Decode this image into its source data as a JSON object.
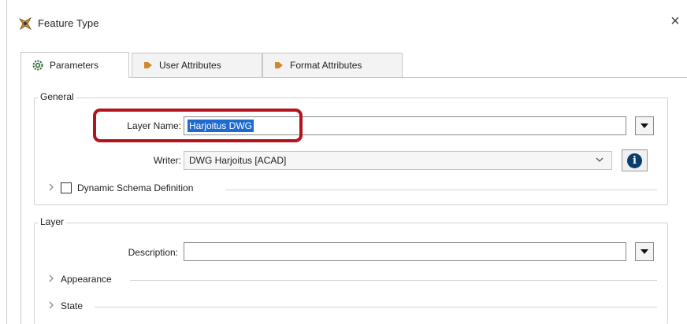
{
  "window": {
    "title": "Feature Type",
    "close_glyph": "×"
  },
  "tabs": [
    {
      "label": "Parameters",
      "icon": "gear-icon",
      "active": true
    },
    {
      "label": "User Attributes",
      "icon": "arrow-right-icon",
      "active": false
    },
    {
      "label": "Format Attributes",
      "icon": "arrow-right-icon",
      "active": false
    }
  ],
  "general": {
    "title": "General",
    "layer_name_label": "Layer Name:",
    "layer_name_value": "Harjoitus DWG",
    "writer_label": "Writer:",
    "writer_value": "DWG Harjoitus [ACAD]",
    "dynamic_schema_label": "Dynamic Schema Definition",
    "dynamic_schema_checked": false,
    "info_glyph": "i"
  },
  "layer": {
    "title": "Layer",
    "description_label": "Description:",
    "description_value": "",
    "appearance_label": "Appearance",
    "state_label": "State"
  },
  "colors": {
    "highlight": "#b3131c",
    "selection": "#1f6ad1",
    "info": "#0a3d6e"
  }
}
